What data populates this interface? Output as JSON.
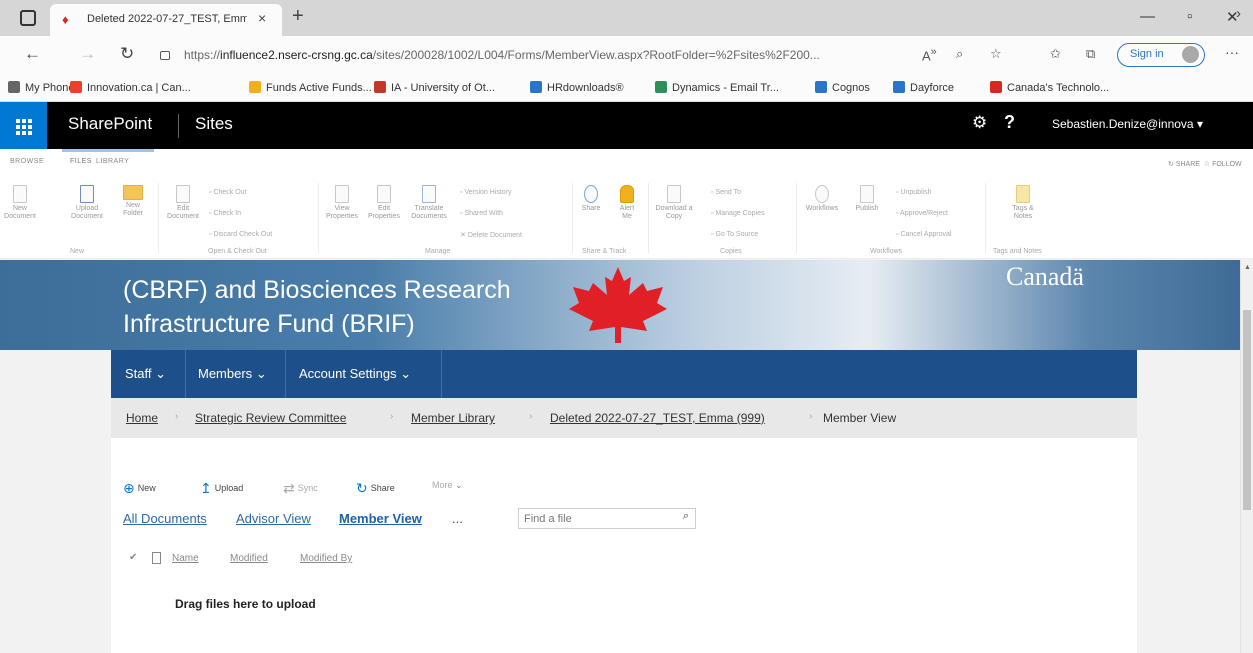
{
  "browser": {
    "tab_title": "Deleted 2022-07-27_TEST, Emm",
    "url_prefix": "https://",
    "url_host": "influence2.nserc-crsng.gc.ca",
    "url_path": "/sites/200028/1002/L004/Forms/MemberView.aspx?RootFolder=%2Fsites%2F200...",
    "signin_label": "Sign in",
    "favorites": [
      {
        "label": "My Phone",
        "color": "#666666"
      },
      {
        "label": "Innovation.ca | Can...",
        "color": "#e8412c"
      },
      {
        "label": "Funds Active Funds...",
        "color": "#f2b01e"
      },
      {
        "label": "IA - University of Ot...",
        "color": "#c0392b"
      },
      {
        "label": "HRdownloads®",
        "color": "#2a74c9"
      },
      {
        "label": "Dynamics - Email Tr...",
        "color": "#2f8f5b"
      },
      {
        "label": "Cognos",
        "color": "#2a74c9"
      },
      {
        "label": "Dayforce",
        "color": "#2a74c9"
      },
      {
        "label": "Canada's Technolo...",
        "color": "#d52b1e"
      }
    ]
  },
  "suitebar": {
    "brand": "SharePoint",
    "sites": "Sites",
    "user": "Sebastien.Denize@innova"
  },
  "ribbon": {
    "tabs": [
      "BROWSE",
      "FILES",
      "LIBRARY"
    ],
    "share": "SHARE",
    "follow": "FOLLOW",
    "buttons": {
      "new_document": "New Document",
      "upload_document": "Upload Document",
      "new_folder": "New Folder",
      "edit_document": "Edit Document",
      "check_out": "Check Out",
      "check_in": "Check In",
      "discard_check_out": "Discard Check Out",
      "view_properties": "View Properties",
      "edit_properties": "Edit Properties",
      "translate_documents": "Translate Documents",
      "version_history": "Version History",
      "shared_with": "Shared With",
      "delete_document": "Delete Document",
      "share": "Share",
      "alert_me": "Alert Me",
      "download_copy": "Download a Copy",
      "send_to": "Send To",
      "manage_copies": "Manage Copies",
      "go_to_source": "Go To Source",
      "workflows": "Workflows",
      "publish": "Publish",
      "unpublish": "Unpublish",
      "approve_reject": "Approve/Reject",
      "cancel_approval": "Cancel Approval",
      "tags_notes": "Tags & Notes"
    },
    "groups": {
      "new": "New",
      "open_check_out": "Open & Check Out",
      "manage": "Manage",
      "share_track": "Share & Track",
      "copies": "Copies",
      "workflows": "Workflows",
      "tags_notes": "Tags and Notes"
    }
  },
  "banner": {
    "title_line1": "(CBRF) and Biosciences Research",
    "title_line2": "Infrastructure Fund (BRIF)",
    "wordmark": "Canadä"
  },
  "topnav": {
    "items": [
      "Staff",
      "Members",
      "Account Settings"
    ]
  },
  "breadcrumb": {
    "home": "Home",
    "committee": "Strategic Review Committee",
    "library": "Member Library",
    "folder": "Deleted 2022-07-27_TEST, Emma (999)",
    "current": "Member View"
  },
  "commands": {
    "new": "New",
    "upload": "Upload",
    "sync": "Sync",
    "share": "Share",
    "more": "More"
  },
  "views": {
    "all_documents": "All Documents",
    "advisor_view": "Advisor View",
    "member_view": "Member View",
    "more": "..."
  },
  "search": {
    "placeholder": "Find a file"
  },
  "columns": {
    "name": "Name",
    "modified": "Modified",
    "modified_by": "Modified By"
  },
  "dropzone": "Drag files here to upload"
}
